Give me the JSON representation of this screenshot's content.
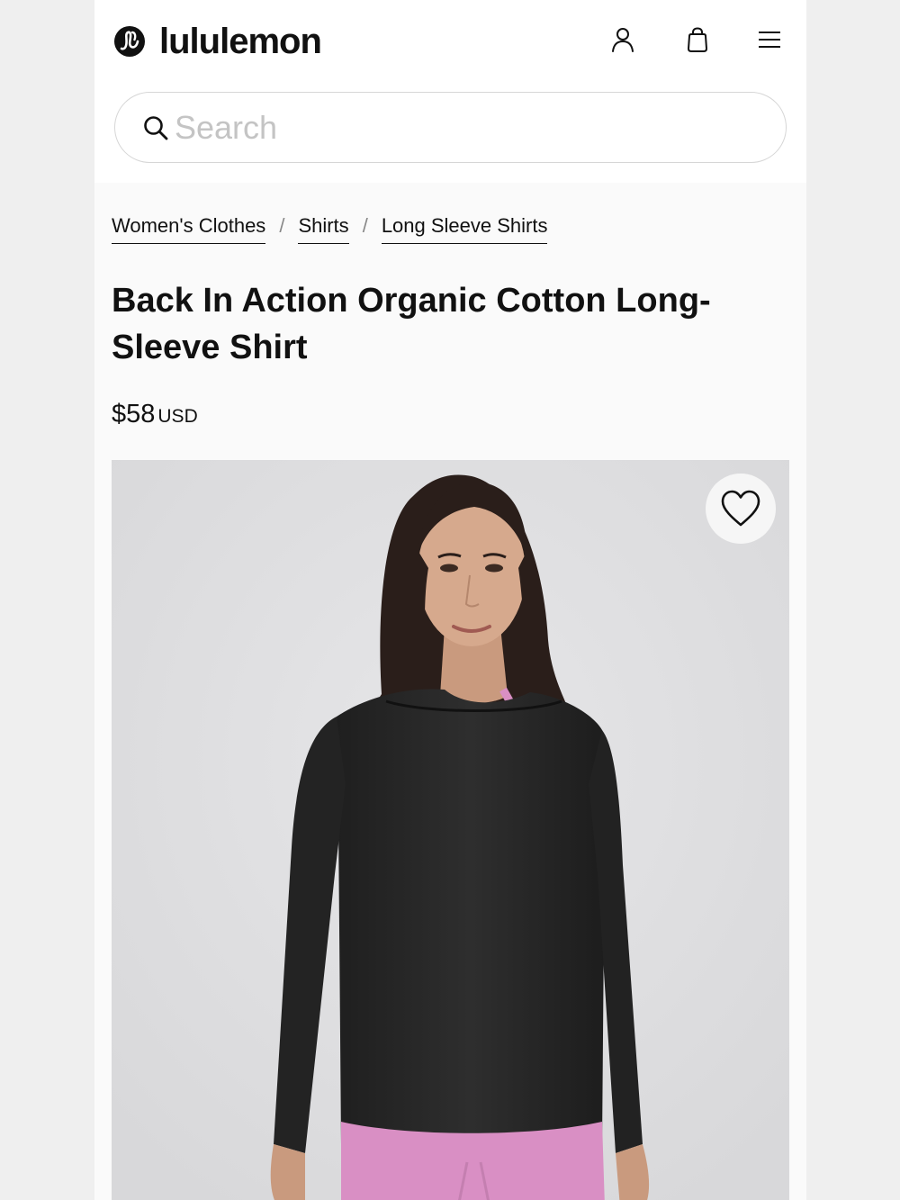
{
  "header": {
    "brand": "lululemon",
    "icons": [
      "account-icon",
      "bag-icon",
      "menu-icon"
    ]
  },
  "search": {
    "placeholder": "Search",
    "value": ""
  },
  "breadcrumb": [
    {
      "label": "Women's Clothes"
    },
    {
      "label": "Shirts"
    },
    {
      "label": "Long Sleeve Shirts"
    }
  ],
  "breadcrumb_separator": "/",
  "product": {
    "title": "Back In Action Organic Cotton Long-Sleeve Shirt",
    "price": "$58",
    "currency": "USD"
  },
  "gallery": {
    "wishlist_icon": "heart-icon"
  },
  "colors": {
    "text": "#111111",
    "shirt": "#2b2b2b",
    "leggings": "#d98fc4",
    "background": "#fafafa"
  }
}
